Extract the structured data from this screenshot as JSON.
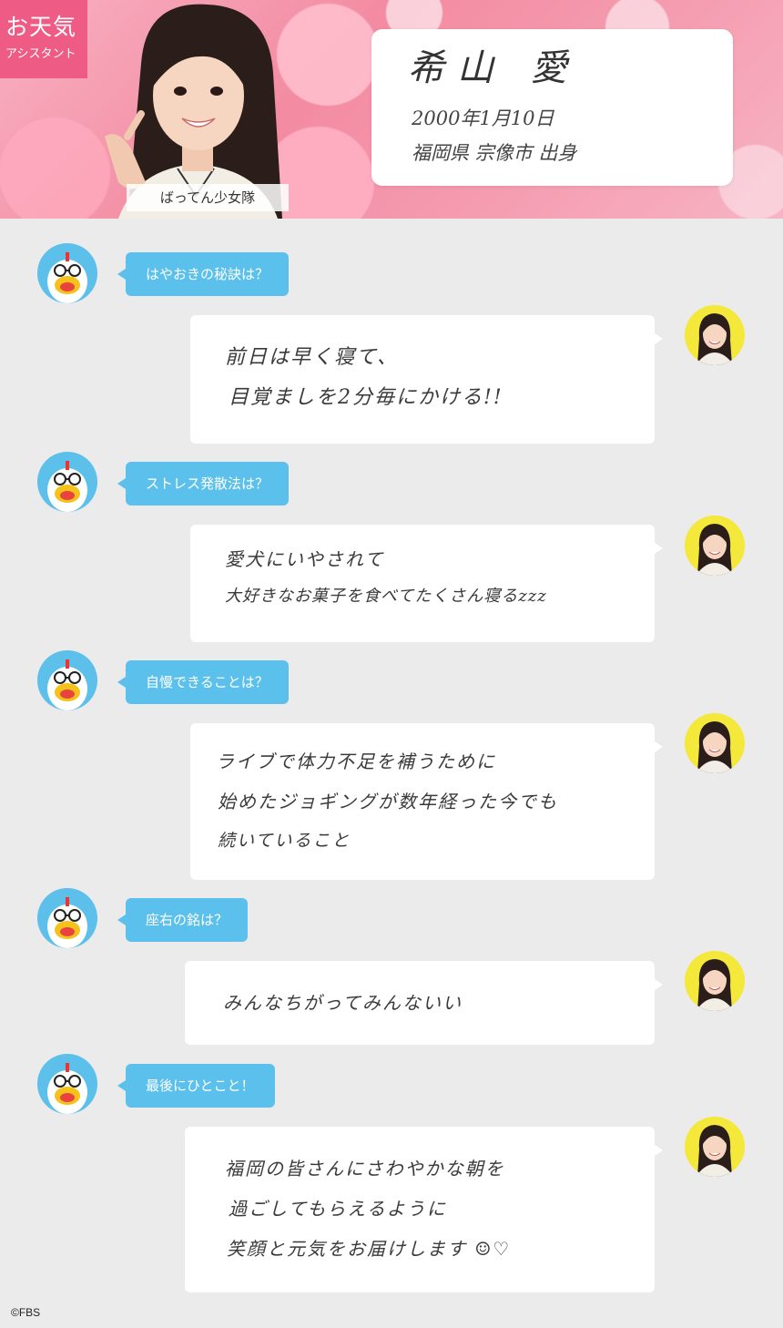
{
  "header": {
    "badge_title": "お天気",
    "badge_subtitle": "アシスタント",
    "group_label": "ばってん少女隊",
    "profile": {
      "name": "希山 愛",
      "birthdate": "2000年1月10日",
      "hometown": "福岡県 宗像市 出身"
    }
  },
  "qa": [
    {
      "question": "はやおきの秘訣は？",
      "answer_lines": [
        "前日は早く寝て、",
        "目覚ましを2分毎にかける!!"
      ]
    },
    {
      "question": "ストレス発散法は？",
      "answer_lines": [
        "愛犬にいやされて",
        "大好きなお菓子を食べてたくさん寝るzzz"
      ]
    },
    {
      "question": "自慢できることは？",
      "answer_lines": [
        "ライブで体力不足を補うために",
        "始めたジョギングが数年経った今でも",
        "続いていること"
      ]
    },
    {
      "question": "座右の銘は？",
      "answer_lines": [
        "みんなちがってみんないい"
      ]
    },
    {
      "question": "最後にひとこと！",
      "answer_lines": [
        "福岡の皆さんにさわやかな朝を",
        "過ごしてもらえるように",
        "笑顔と元気をお届けします ☺♡"
      ]
    }
  ],
  "footer": {
    "copyright": "©FBS"
  },
  "colors": {
    "badge": "#ee5b85",
    "question_bubble": "#5bc1ec",
    "mascot_bg": "#5cc0ea",
    "avatar_bg": "#f4e83a",
    "page_bg": "#ebebeb"
  }
}
